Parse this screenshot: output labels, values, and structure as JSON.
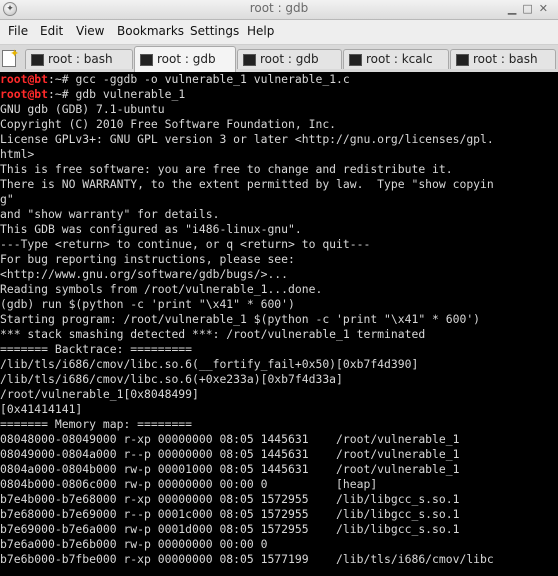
{
  "window": {
    "title": "root : gdb"
  },
  "menu": [
    "File",
    "Edit",
    "View",
    "Bookmarks",
    "Settings",
    "Help"
  ],
  "tabs": [
    {
      "label": "root : bash",
      "active": false
    },
    {
      "label": "root : gdb",
      "active": true
    },
    {
      "label": "root : gdb",
      "active": false
    },
    {
      "label": "root : kcalc",
      "active": false
    },
    {
      "label": "root : bash",
      "active": false
    }
  ],
  "terminal": {
    "prompt_user": "root",
    "prompt_host": "bt",
    "prompt_suffix": ":~# ",
    "commands": [
      "gcc -ggdb -o vulnerable_1 vulnerable_1.c",
      "gdb vulnerable_1"
    ],
    "output": [
      "GNU gdb (GDB) 7.1-ubuntu",
      "Copyright (C) 2010 Free Software Foundation, Inc.",
      "License GPLv3+: GNU GPL version 3 or later <http://gnu.org/licenses/gpl.",
      "html>",
      "This is free software: you are free to change and redistribute it.",
      "There is NO WARRANTY, to the extent permitted by law.  Type \"show copyin",
      "g\"",
      "and \"show warranty\" for details.",
      "This GDB was configured as \"i486-linux-gnu\".",
      "---Type <return> to continue, or q <return> to quit---",
      "For bug reporting instructions, please see:",
      "<http://www.gnu.org/software/gdb/bugs/>...",
      "Reading symbols from /root/vulnerable_1...done.",
      "(gdb) run $(python -c 'print \"\\x41\" * 600')",
      "Starting program: /root/vulnerable_1 $(python -c 'print \"\\x41\" * 600')",
      "*** stack smashing detected ***: /root/vulnerable_1 terminated",
      "======= Backtrace: =========",
      "/lib/tls/i686/cmov/libc.so.6(__fortify_fail+0x50)[0xb7f4d390]",
      "/lib/tls/i686/cmov/libc.so.6(+0xe233a)[0xb7f4d33a]",
      "/root/vulnerable_1[0x8048499]",
      "[0x41414141]",
      "======= Memory map: ========",
      "08048000-08049000 r-xp 00000000 08:05 1445631    /root/vulnerable_1",
      "08049000-0804a000 r--p 00000000 08:05 1445631    /root/vulnerable_1",
      "0804a000-0804b000 rw-p 00001000 08:05 1445631    /root/vulnerable_1",
      "0804b000-0806c000 rw-p 00000000 00:00 0          [heap]",
      "b7e4b000-b7e68000 r-xp 00000000 08:05 1572955    /lib/libgcc_s.so.1",
      "b7e68000-b7e69000 r--p 0001c000 08:05 1572955    /lib/libgcc_s.so.1",
      "b7e69000-b7e6a000 rw-p 0001d000 08:05 1572955    /lib/libgcc_s.so.1",
      "b7e6a000-b7e6b000 rw-p 00000000 00:00 0",
      "b7e6b000-b7fbe000 r-xp 00000000 08:05 1577199    /lib/tls/i686/cmov/libc"
    ]
  }
}
